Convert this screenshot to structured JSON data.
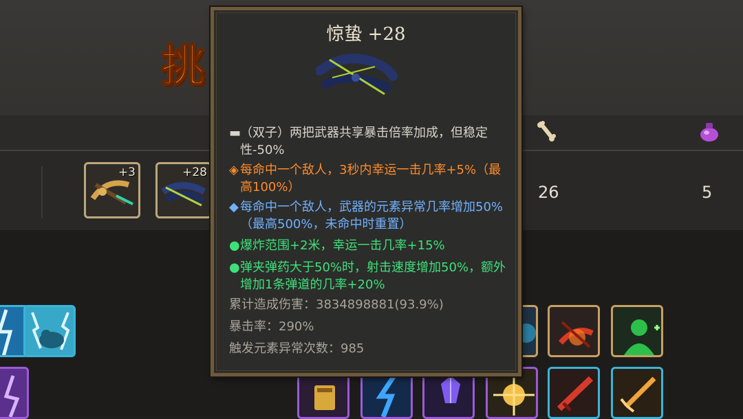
{
  "title_partial": "挑",
  "weapon_slots": [
    {
      "level": "+3"
    },
    {
      "level": "+28"
    }
  ],
  "stats_values": [
    "26",
    "5"
  ],
  "tooltip": {
    "name": "惊蛰 +28",
    "line1": "（双子）两把武器共享暴击倍率加成，但稳定性-50%",
    "line2": "每命中一个敌人，3秒内幸运一击几率+5%（最高100%）",
    "line3": "每命中一个敌人，武器的元素异常几率增加50%（最高500%，未命中时重置）",
    "line4": "爆炸范围+2米，幸运一击几率+15%",
    "line5": "弹夹弹药大于50%时，射击速度增加50%，额外增加1条弹道的几率+20%",
    "stat_damage": "累计造成伤害：3834898881(93.9%)",
    "stat_crit": "暴击率：290%",
    "stat_elemental": "触发元素异常次数：985"
  },
  "colors": {
    "gray_line": "#d8d4cb",
    "orange_line": "#ff8b2b",
    "blue_line": "#6fb1ff",
    "green_line": "#3ee07a",
    "stat_text": "#a9a49a",
    "slot_border": "#bda77c",
    "tooltip_border": "#6e5a3c"
  },
  "icons": {
    "weapon_preview": "crossbow-dark-blue-icon",
    "gray_bullet": "dash-bullet-icon",
    "orange_bullet": "diamond-bullet-icon",
    "blue_bullet": "diamond-bullet-icon",
    "green_bullet": "dot-bullet-icon"
  }
}
